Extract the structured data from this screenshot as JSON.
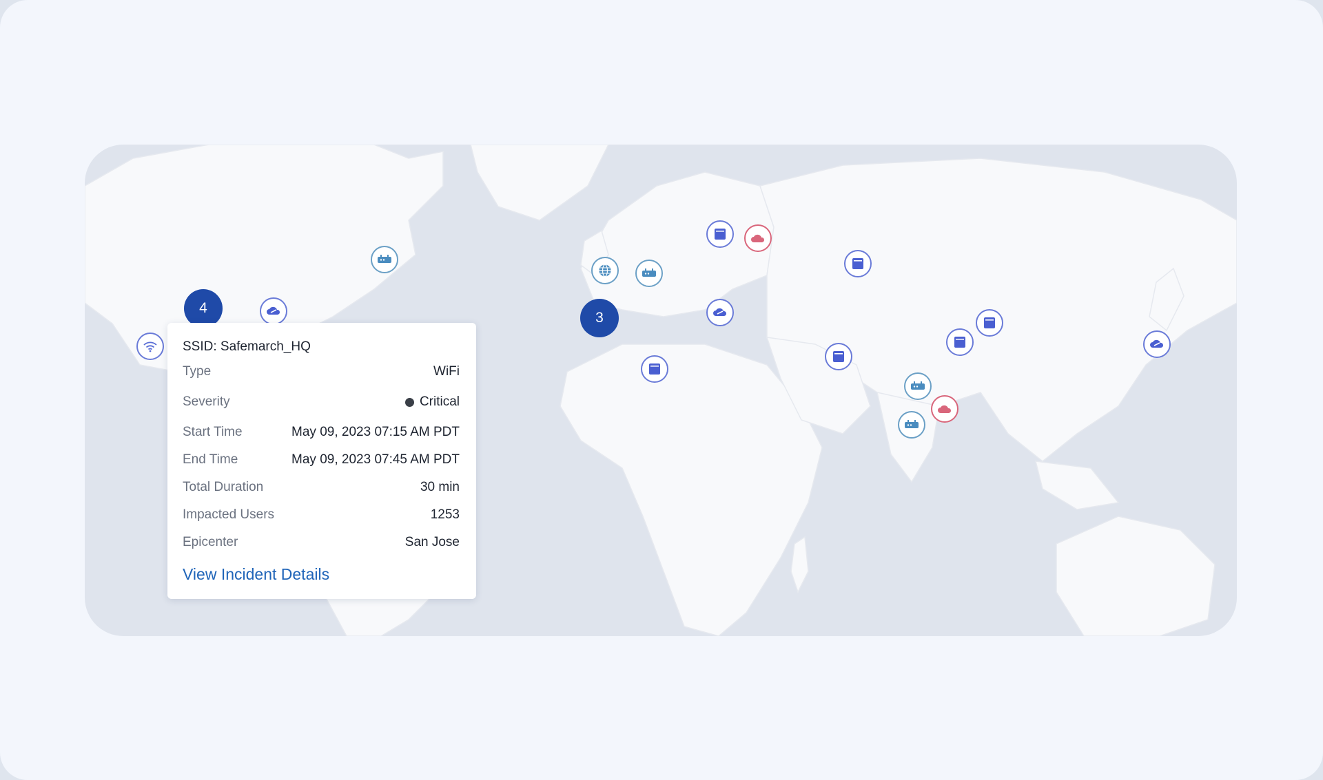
{
  "map": {
    "markers": [
      {
        "name": "router-icon",
        "style": "teal"
      },
      {
        "name": "cloud-link-icon",
        "style": "blue"
      },
      {
        "name": "wifi-icon",
        "style": "blue"
      },
      {
        "name": "globe-icon",
        "style": "teal"
      },
      {
        "name": "router-icon",
        "style": "teal"
      },
      {
        "name": "server-icon",
        "style": "blue"
      },
      {
        "name": "cloud-icon",
        "style": "red"
      },
      {
        "name": "cloud-link-icon",
        "style": "blue"
      },
      {
        "name": "server-icon",
        "style": "blue"
      },
      {
        "name": "server-icon",
        "style": "blue"
      },
      {
        "name": "server-icon",
        "style": "blue"
      },
      {
        "name": "server-icon",
        "style": "blue"
      },
      {
        "name": "server-icon",
        "style": "blue"
      },
      {
        "name": "router-icon",
        "style": "teal"
      },
      {
        "name": "cloud-icon",
        "style": "red"
      },
      {
        "name": "router-icon",
        "style": "teal"
      },
      {
        "name": "cloud-link-icon",
        "style": "blue"
      }
    ],
    "clusters": [
      {
        "count": "4"
      },
      {
        "count": "3"
      }
    ],
    "colors": {
      "ocean": "#dfe4ed",
      "land": "#f8f9fb",
      "cluster": "#1f4aa8",
      "marker_blue": "#6a7bd8",
      "marker_teal": "#6ba0c6",
      "marker_red": "#d9667b"
    }
  },
  "tooltip": {
    "title": "SSID: Safemarch_HQ",
    "rows": [
      {
        "label": "Type",
        "value": "WiFi"
      },
      {
        "label": "Severity",
        "value": "Critical"
      },
      {
        "label": "Start Time",
        "value": "May 09, 2023 07:15 AM PDT"
      },
      {
        "label": "End Time",
        "value": "May 09, 2023 07:45 AM PDT"
      },
      {
        "label": "Total Duration",
        "value": "30 min"
      },
      {
        "label": "Impacted Users",
        "value": "1253"
      },
      {
        "label": "Epicenter",
        "value": "San Jose"
      }
    ],
    "link": "View Incident Details",
    "severity_color": "#3a3f47"
  }
}
